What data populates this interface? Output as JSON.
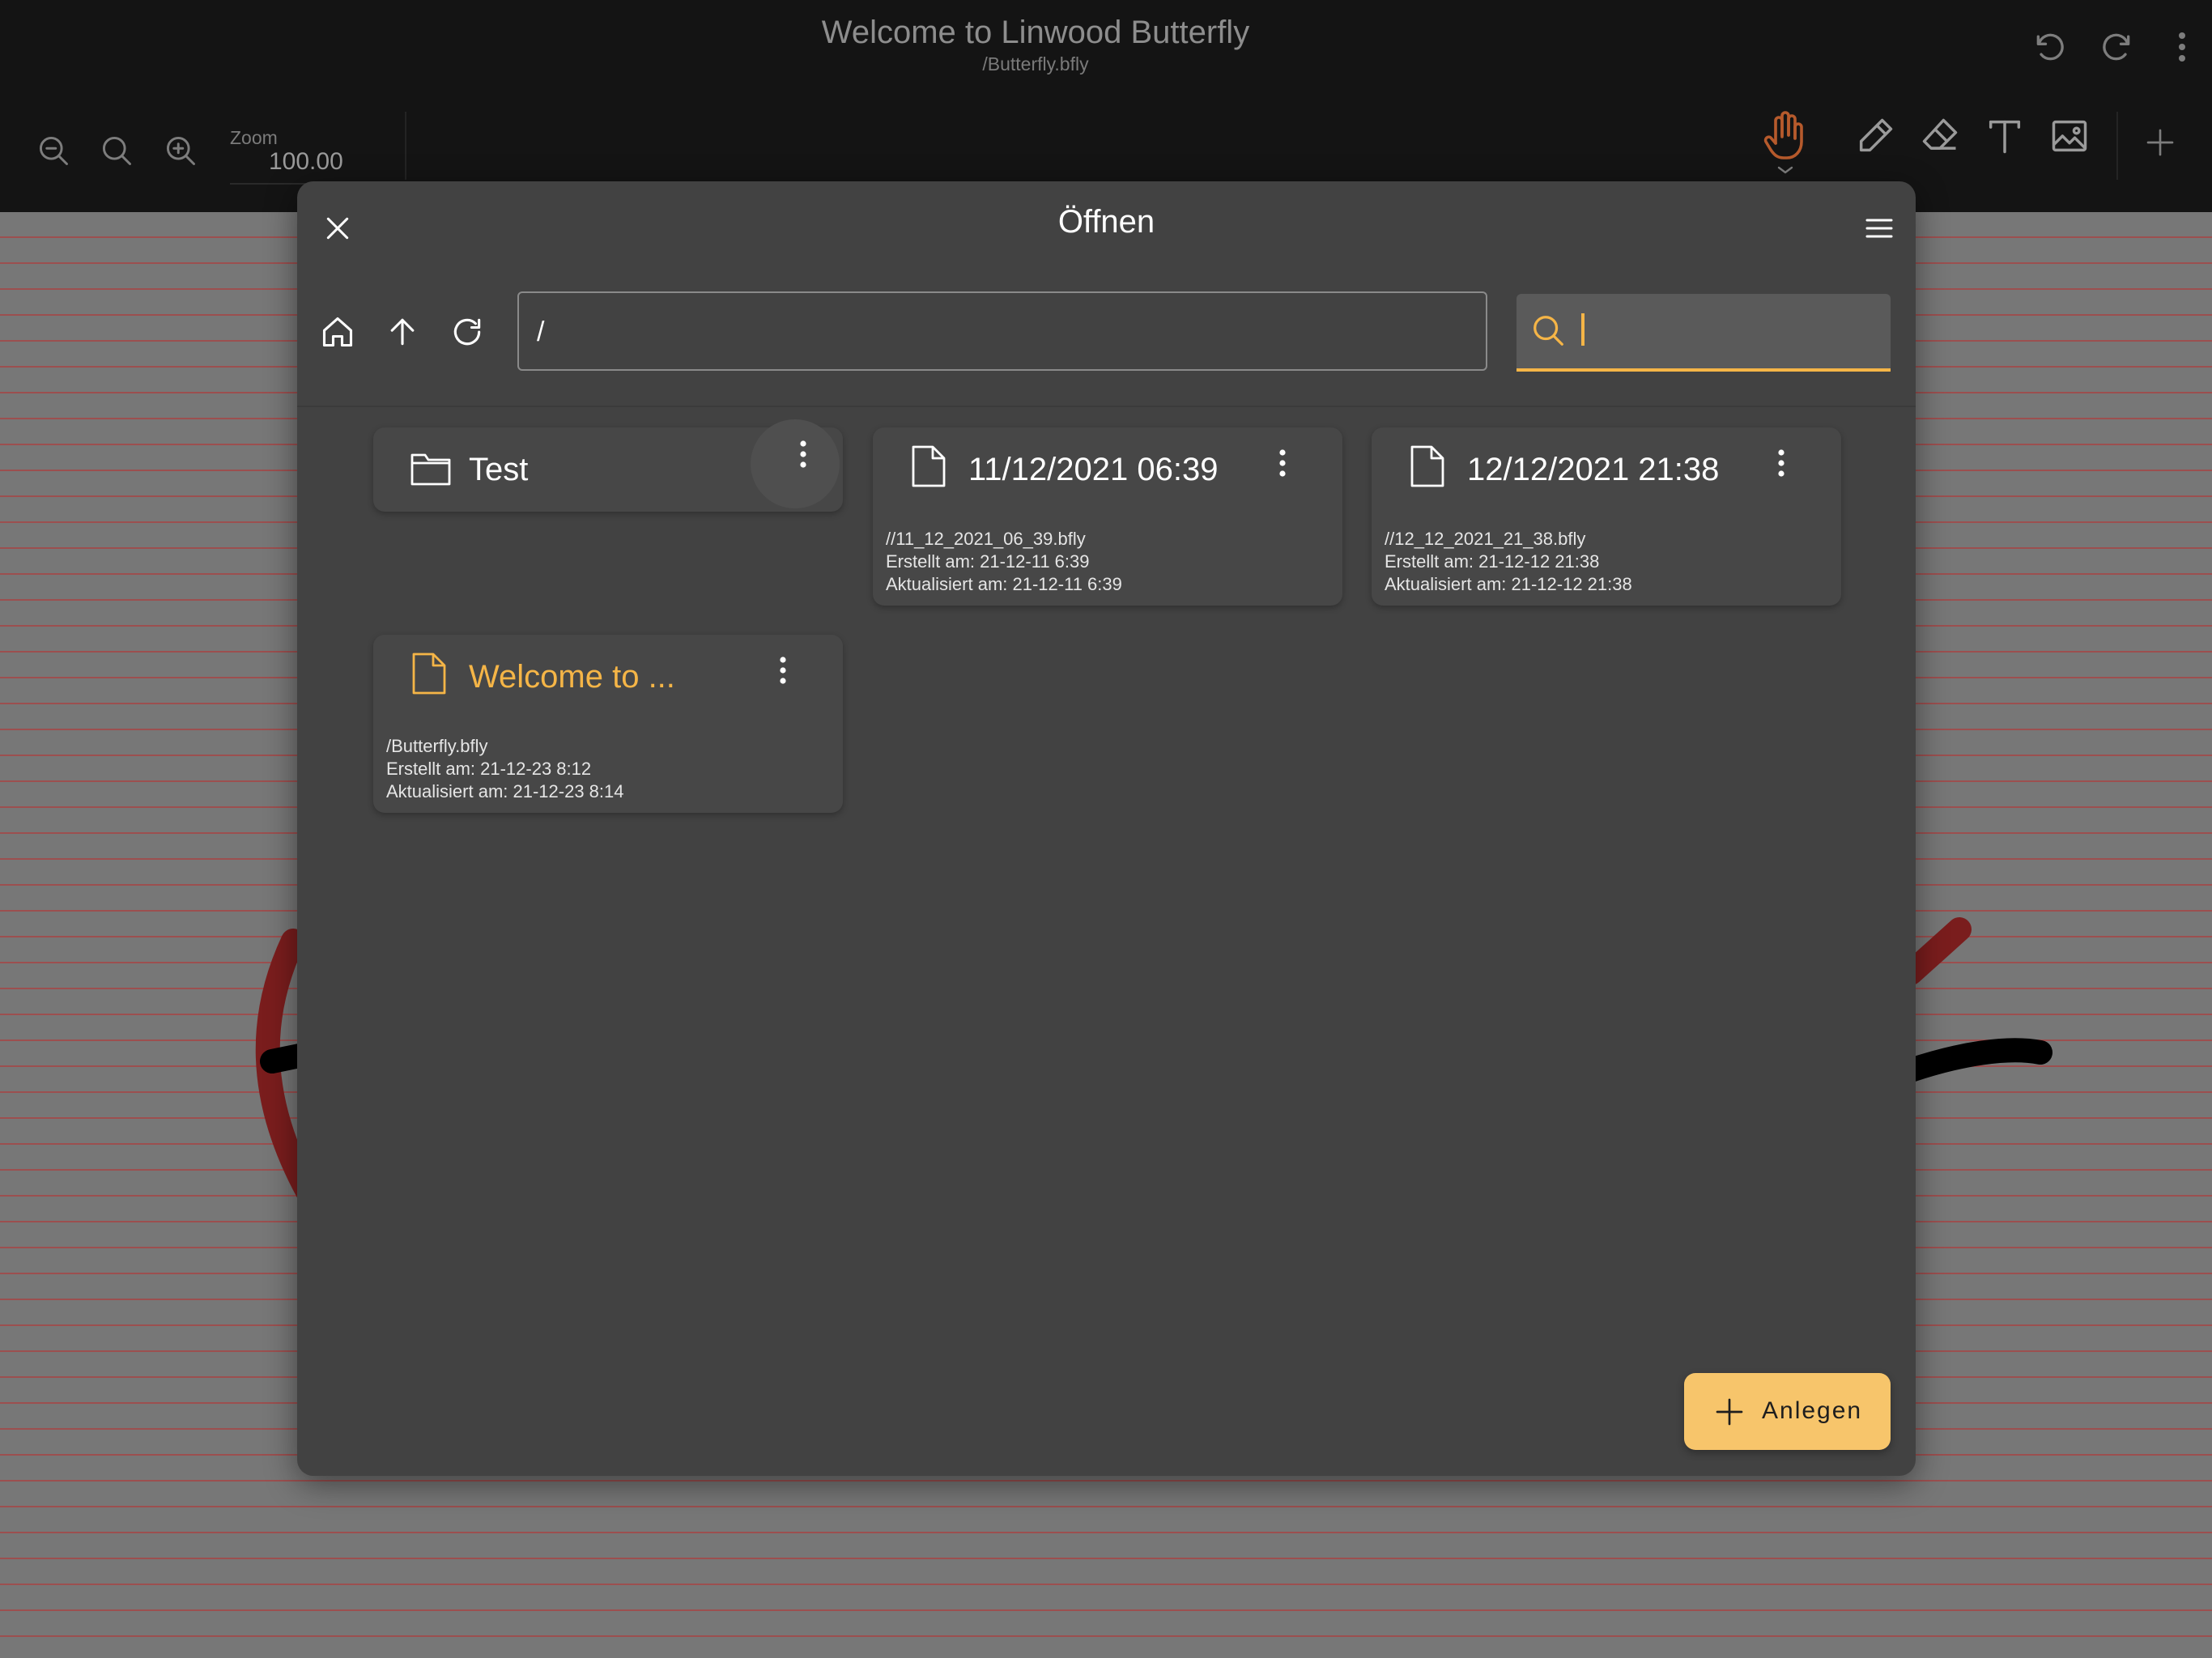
{
  "app": {
    "title": "Welcome to Linwood Butterfly",
    "subtitle": "/Butterfly.bfly",
    "zoom_label": "Zoom",
    "zoom_value": "100.00"
  },
  "icons": {
    "undo": "undo-icon",
    "redo": "redo-icon",
    "more": "more-vert-icon",
    "zoom_out": "zoom-out-icon",
    "zoom_reset": "zoom-reset-icon",
    "zoom_in": "zoom-in-icon",
    "hand": "hand-tool-icon",
    "pen": "pen-tool-icon",
    "eraser": "eraser-tool-icon",
    "text": "text-tool-icon",
    "image": "image-tool-icon",
    "add": "add-tool-icon"
  },
  "colors": {
    "accent": "#f5b547",
    "fab": "#f7c56b",
    "hand_tool": "#b65a2c",
    "stroke_red": "#7a1d1d",
    "stroke_black": "#000000"
  },
  "dialog": {
    "title": "Öffnen",
    "path_value": "/",
    "search_value": "",
    "create_label": "Anlegen",
    "items": [
      {
        "type": "folder",
        "name": "Test"
      },
      {
        "type": "file",
        "name": "11/12/2021 06:39",
        "path": "//11_12_2021_06_39.bfly",
        "created": "Erstellt am: 21-12-11 6:39",
        "updated": "Aktualisiert am: 21-12-11 6:39"
      },
      {
        "type": "file",
        "name": "12/12/2021 21:38",
        "path": "//12_12_2021_21_38.bfly",
        "created": "Erstellt am: 21-12-12 21:38",
        "updated": "Aktualisiert am: 21-12-12 21:38"
      },
      {
        "type": "file",
        "name": "Welcome to ...",
        "path": "/Butterfly.bfly",
        "created": "Erstellt am: 21-12-23 8:12",
        "updated": "Aktualisiert am: 21-12-23 8:14",
        "current": true
      }
    ]
  }
}
